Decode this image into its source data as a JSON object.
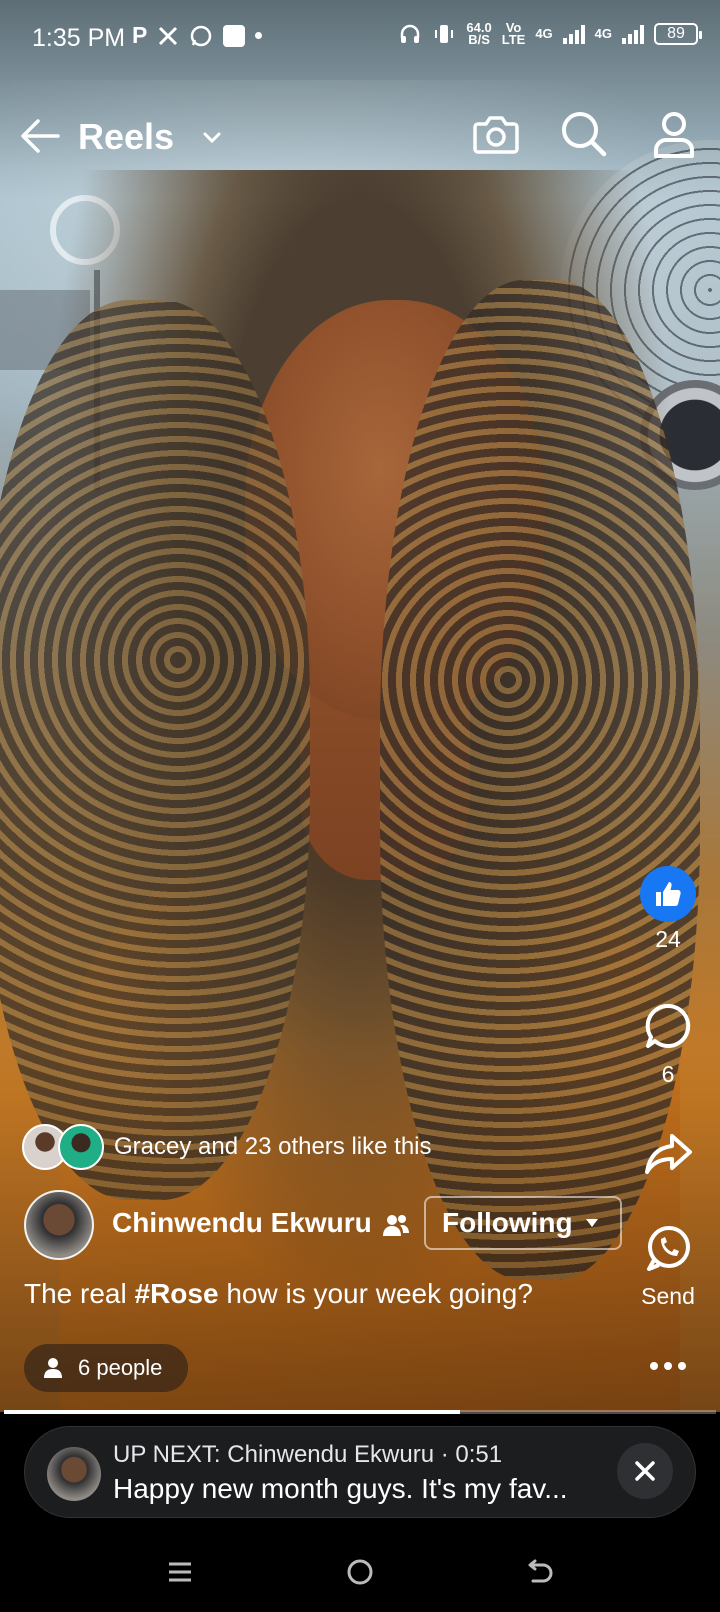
{
  "status_bar": {
    "time": "1:35 PM",
    "notif_icons": [
      "p-icon",
      "x-icon",
      "whatsapp-icon",
      "square-icon",
      "dot-icon"
    ],
    "speed_value": "64.0",
    "speed_unit": "B/S",
    "volte": "Vo",
    "volte_sub": "LTE",
    "net1": "4G",
    "net2": "4G",
    "battery": "89"
  },
  "header": {
    "title": "Reels"
  },
  "actions": {
    "like_count": "24",
    "comment_count": "6",
    "send_label": "Send"
  },
  "post": {
    "likes_text": "Gracey and 23 others like this",
    "author": "Chinwendu Ekwuru",
    "follow_label": "Following",
    "caption_prefix": "The real ",
    "caption_hashtag": "#Rose",
    "caption_suffix": " how is your week going?",
    "people_label": "6 people"
  },
  "progress": {
    "fraction": 0.64
  },
  "up_next": {
    "line1": "UP NEXT: Chinwendu Ekwuru · 0:51",
    "line2": "Happy new month guys. It's my fav..."
  },
  "colors": {
    "like_blue": "#1877f2",
    "upnext_bg": "#1c1d1f"
  }
}
